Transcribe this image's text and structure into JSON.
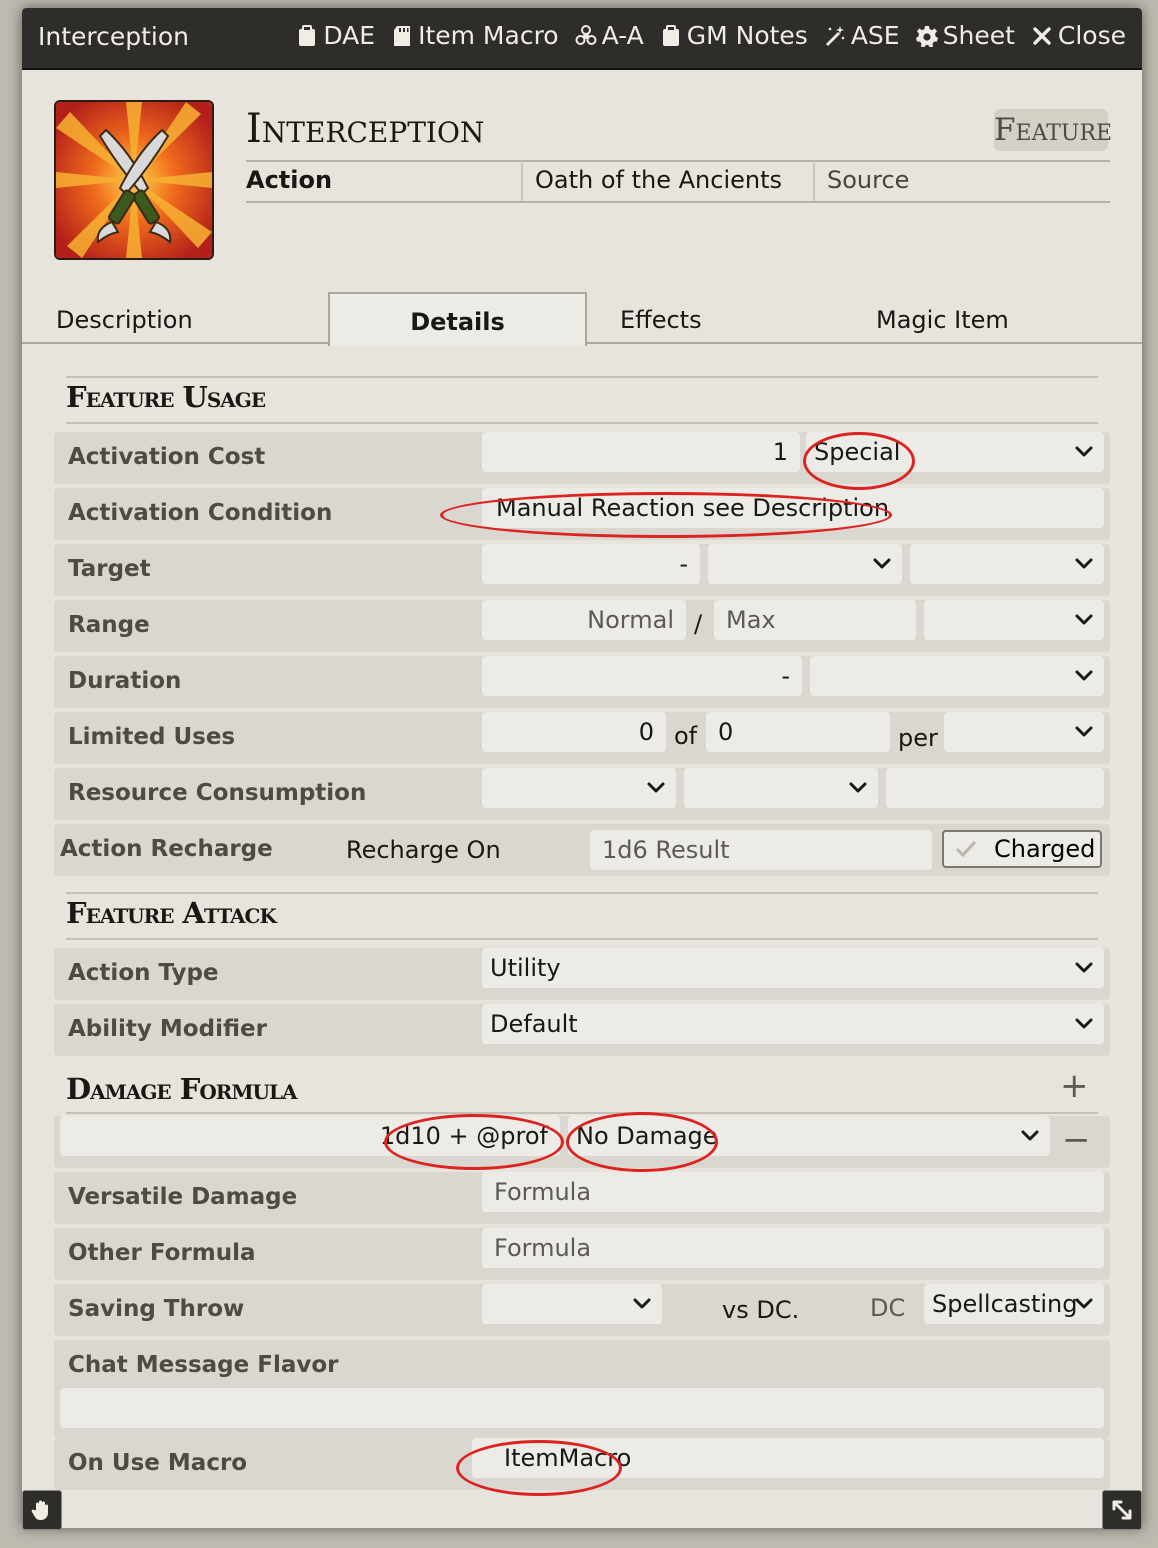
{
  "window": {
    "title": "Interception",
    "header_buttons": [
      {
        "icon": "clipboard-icon",
        "label": "DAE"
      },
      {
        "icon": "sd-card-icon",
        "label": "Item Macro"
      },
      {
        "icon": "biohazard-icon",
        "label": "A-A"
      },
      {
        "icon": "clipboard-icon",
        "label": "GM Notes"
      },
      {
        "icon": "magic-wand-icon",
        "label": "ASE"
      },
      {
        "icon": "gear-icon",
        "label": "Sheet"
      },
      {
        "icon": "close-icon",
        "label": "Close"
      }
    ]
  },
  "item": {
    "name": "Interception",
    "type": "Feature",
    "activation": "Action",
    "requirements": "Oath of the Ancients",
    "source_placeholder": "Source",
    "portrait_icon": "crossed-daggers-icon"
  },
  "tabs": [
    "Description",
    "Details",
    "Effects",
    "Magic Item"
  ],
  "active_tab": "Details",
  "feature_usage": {
    "title": "Feature Usage",
    "activation_cost": {
      "label": "Activation Cost",
      "value": "1",
      "type": "Special"
    },
    "activation_condition": {
      "label": "Activation Condition",
      "value": "Manual Reaction see Description"
    },
    "target": {
      "label": "Target",
      "value": "-"
    },
    "range": {
      "label": "Range",
      "normal_placeholder": "Normal",
      "separator": "/",
      "max_placeholder": "Max"
    },
    "duration": {
      "label": "Duration",
      "value": "-"
    },
    "limited_uses": {
      "label": "Limited Uses",
      "value": "0",
      "of_label": "of",
      "max": "0",
      "per_label": "per"
    },
    "resource_consumption": {
      "label": "Resource Consumption"
    },
    "action_recharge": {
      "label": "Action Recharge",
      "recharge_on": "Recharge On",
      "placeholder": "1d6 Result",
      "charged_label": "Charged"
    }
  },
  "feature_attack": {
    "title": "Feature Attack",
    "action_type": {
      "label": "Action Type",
      "value": "Utility"
    },
    "ability_modifier": {
      "label": "Ability Modifier",
      "value": "Default"
    }
  },
  "damage_formula": {
    "title": "Damage Formula",
    "add_symbol": "+",
    "remove_symbol": "−",
    "formula": "1d10 + @prof",
    "damage_type": "No Damage",
    "versatile": {
      "label": "Versatile Damage",
      "placeholder": "Formula"
    },
    "other": {
      "label": "Other Formula",
      "placeholder": "Formula"
    },
    "saving_throw": {
      "label": "Saving Throw",
      "vs_label": "vs DC.",
      "dc_label": "DC",
      "dc_value": "Spellcasting"
    },
    "chat_flavor": {
      "label": "Chat Message Flavor",
      "value": ""
    },
    "on_use_macro": {
      "label": "On Use Macro",
      "value": "ItemMacro"
    }
  },
  "colors": {
    "highlight": "#dd2222",
    "titlebar": "#2e2d2a",
    "background": "#e6e4dc"
  }
}
